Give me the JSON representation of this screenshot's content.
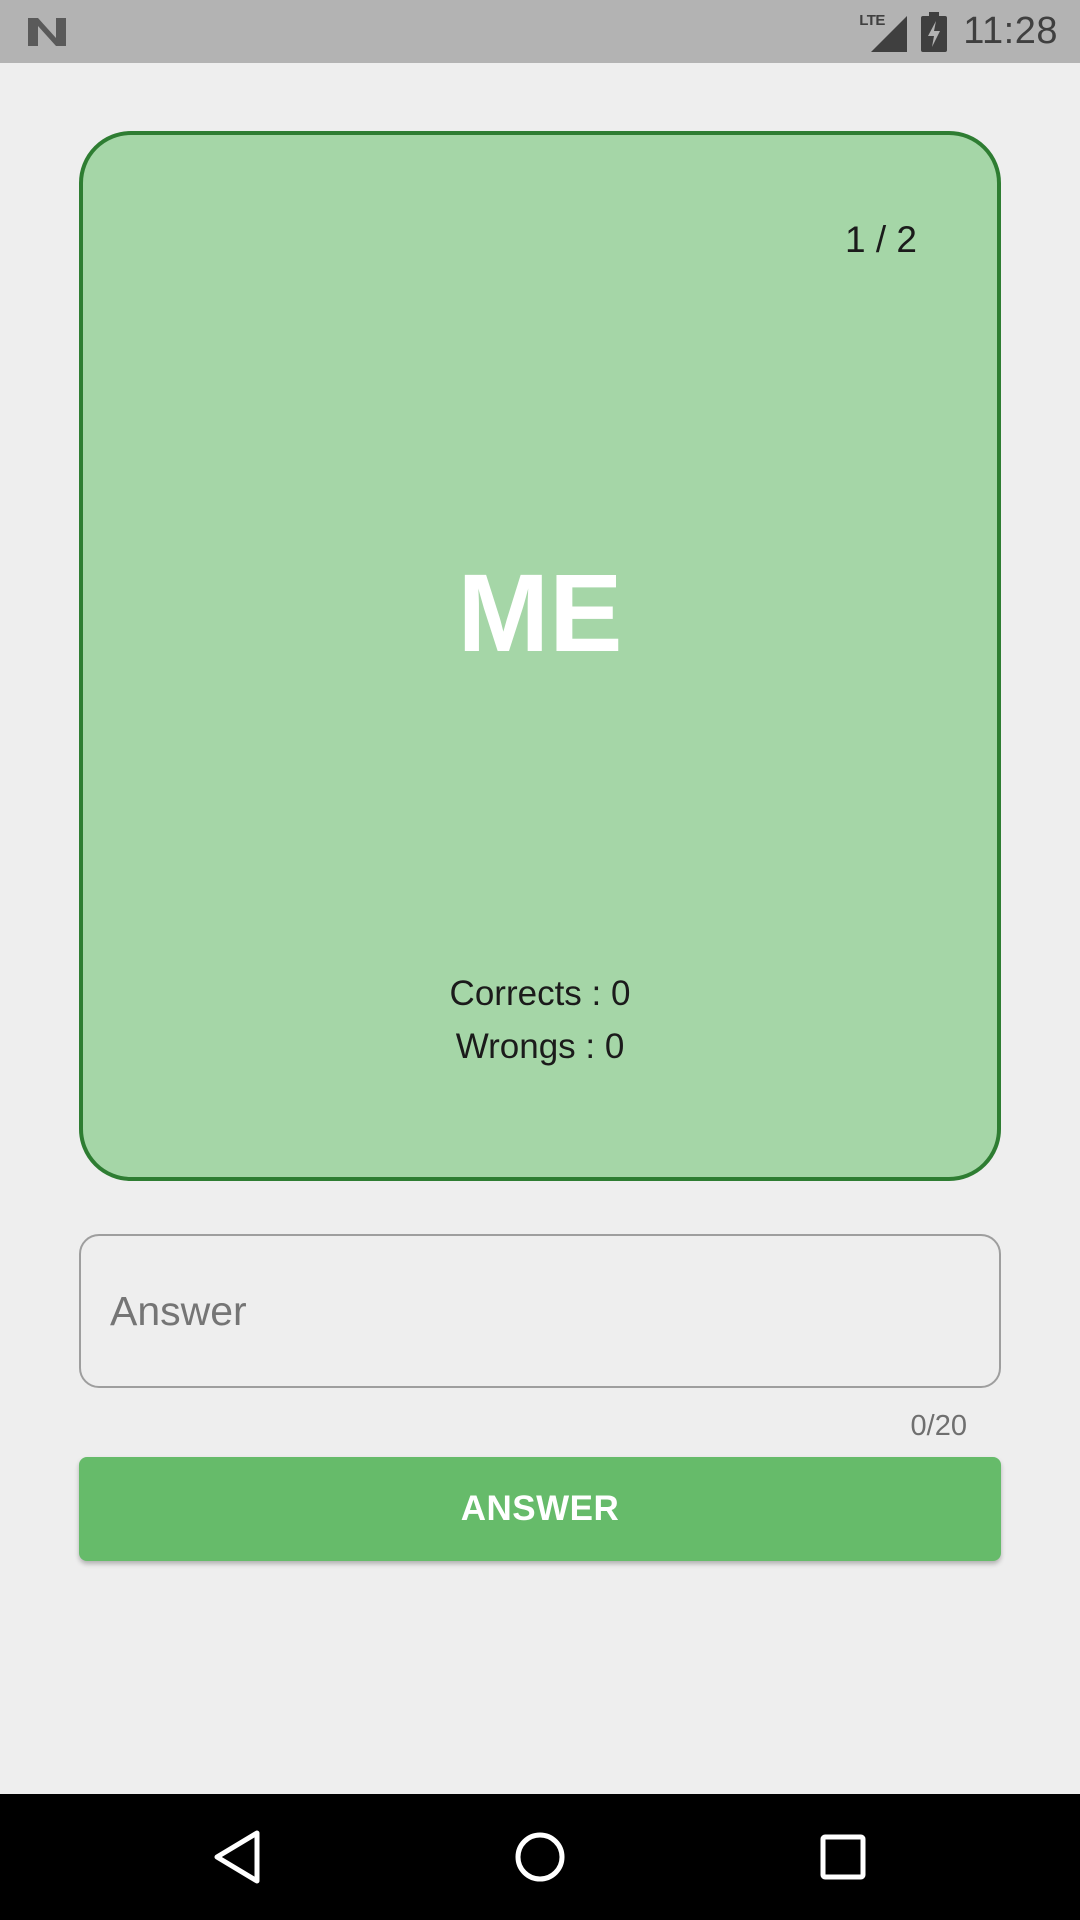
{
  "status_bar": {
    "network": "LTE",
    "time": "11:28"
  },
  "card": {
    "progress": "1 / 2",
    "word": "ME",
    "corrects_label": "Corrects : 0",
    "wrongs_label": "Wrongs : 0",
    "colors": {
      "fill": "#a5d6a7",
      "border": "#2e7d32"
    }
  },
  "answer_field": {
    "value": "",
    "placeholder": "Answer",
    "counter": "0/20"
  },
  "answer_button": {
    "label": "ANSWER",
    "color": "#66bb6a"
  },
  "nav_bar": {
    "icons": [
      "back-icon",
      "home-icon",
      "recents-icon"
    ]
  }
}
